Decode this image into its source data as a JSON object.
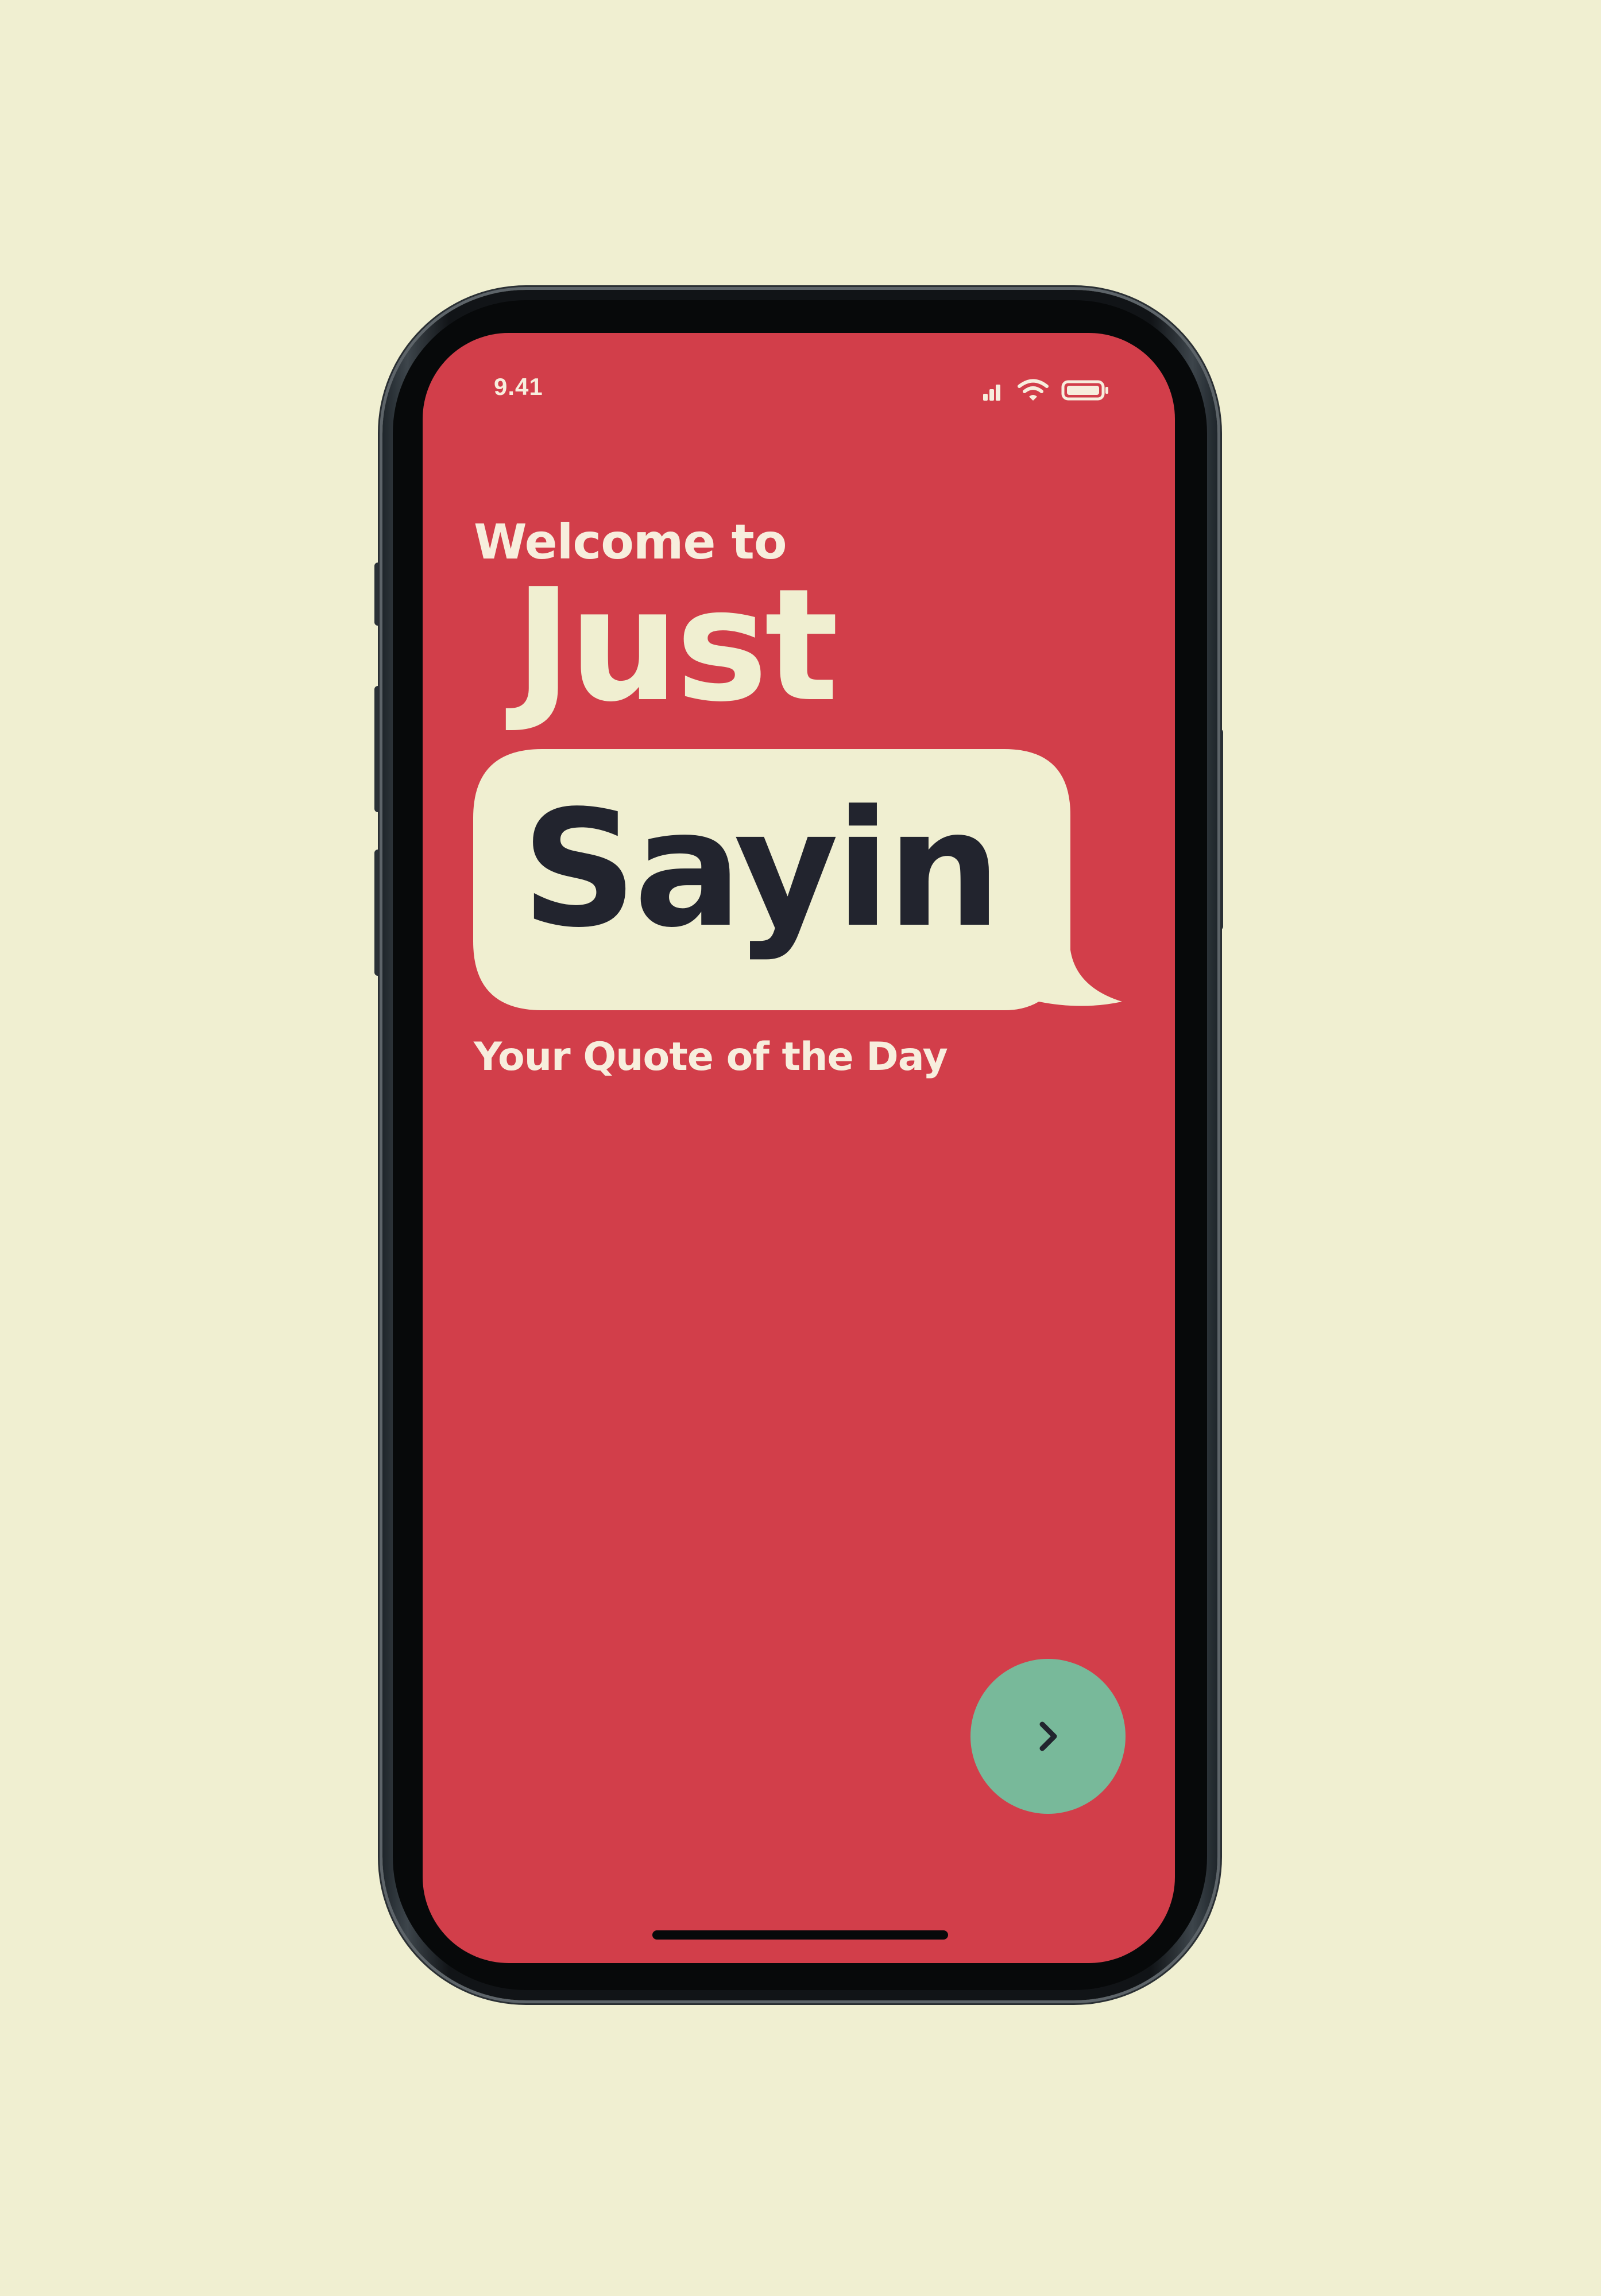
{
  "status_bar": {
    "time": "9.41",
    "icons": [
      "signal-icon",
      "wifi-icon",
      "battery-icon"
    ]
  },
  "onboarding": {
    "welcome": "Welcome to",
    "logo_word_1": "Just",
    "logo_word_2": "Sayin",
    "tagline": "Your Quote of the Day",
    "next_button_icon": "chevron-right-icon"
  },
  "colors": {
    "background": "#f0efd1",
    "screen": "#d23e4a",
    "bubble": "#f0efd1",
    "logo_dark": "#22242e",
    "button": "#78b99a"
  }
}
